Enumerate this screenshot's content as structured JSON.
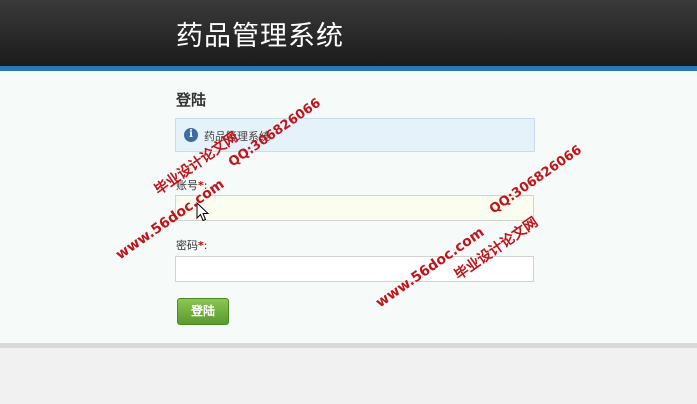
{
  "header": {
    "title": "药品管理系统",
    "bg_color": "#222222",
    "accent_color": "#2c76b7"
  },
  "main": {
    "page_title": "登陆",
    "info": {
      "icon": "info-icon",
      "icon_glyph": "i",
      "text": "药品管理系统"
    },
    "form": {
      "account": {
        "label": "账号",
        "required_mark": "*",
        "colon": ":",
        "value": ""
      },
      "password": {
        "label": "密码",
        "required_mark": "*",
        "colon": ":",
        "value": ""
      },
      "submit_label": "登陆",
      "submit_color": "#6aa83a"
    }
  },
  "watermarks": {
    "site_1": "www.56doc.com",
    "site_2": "www.56doc.com",
    "name_1": "毕业设计论文网",
    "name_2": "毕业设计论文网",
    "qq_1": "QQ:306826066",
    "qq_2": "QQ:306826066",
    "color": "#c0141b"
  }
}
